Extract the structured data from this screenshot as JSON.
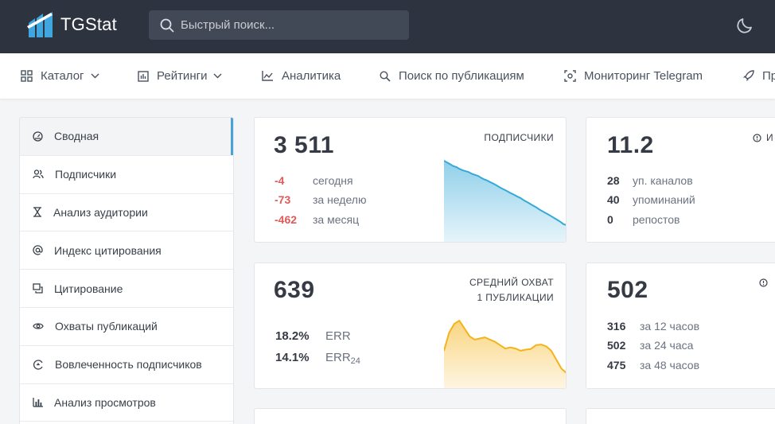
{
  "header": {
    "logo_text": "TGStat",
    "search_placeholder": "Быстрый поиск..."
  },
  "nav": {
    "items": [
      {
        "label": "Каталог",
        "icon": "grid-icon",
        "dropdown": true
      },
      {
        "label": "Рейтинги",
        "icon": "chart-box-icon",
        "dropdown": true
      },
      {
        "label": "Аналитика",
        "icon": "line-chart-icon",
        "dropdown": false
      },
      {
        "label": "Поиск по публикациям",
        "icon": "search-icon",
        "dropdown": false
      },
      {
        "label": "Мониторинг Telegram",
        "icon": "monitor-icon",
        "dropdown": false
      },
      {
        "label": "Пр",
        "icon": "rocket-icon",
        "dropdown": false
      }
    ]
  },
  "sidebar": {
    "items": [
      {
        "label": "Сводная",
        "icon": "dashboard-icon"
      },
      {
        "label": "Подписчики",
        "icon": "users-icon"
      },
      {
        "label": "Анализ аудитории",
        "icon": "hourglass-icon"
      },
      {
        "label": "Индекс цитирования",
        "icon": "at-icon"
      },
      {
        "label": "Цитирование",
        "icon": "quote-icon"
      },
      {
        "label": "Охваты публикаций",
        "icon": "eye-icon"
      },
      {
        "label": "Вовлеченность подписчиков",
        "icon": "engagement-icon"
      },
      {
        "label": "Анализ просмотров",
        "icon": "bar-chart-icon"
      }
    ]
  },
  "cards": {
    "subscribers": {
      "value": "3 511",
      "title": "подписчики",
      "rows": [
        {
          "value": "-4",
          "label": "сегодня"
        },
        {
          "value": "-73",
          "label": "за неделю"
        },
        {
          "value": "-462",
          "label": "за месяц"
        }
      ],
      "color": "#35a9d8"
    },
    "citation": {
      "value": "11.2",
      "title_partial": "И",
      "rows": [
        {
          "value": "28",
          "label": "уп. каналов"
        },
        {
          "value": "40",
          "label": "упоминаний"
        },
        {
          "value": "0",
          "label": "репостов"
        }
      ]
    },
    "reach": {
      "value": "639",
      "title_line1": "средний охват",
      "title_line2": "1 публикации",
      "rows": [
        {
          "value": "18.2%",
          "label": "ERR",
          "sub": ""
        },
        {
          "value": "14.1%",
          "label": "ERR",
          "sub": "24"
        }
      ],
      "color": "#f5b31b"
    },
    "views": {
      "value": "502",
      "rows": [
        {
          "value": "316",
          "label": "за 12 часов"
        },
        {
          "value": "502",
          "label": "за 24 часа"
        },
        {
          "value": "475",
          "label": "за 48 часов"
        }
      ]
    }
  },
  "chart_data": [
    {
      "type": "area",
      "name": "subscribers-trend",
      "values": [
        3973,
        3960,
        3948,
        3935,
        3928,
        3915,
        3905,
        3898,
        3892,
        3880,
        3872,
        3865,
        3852,
        3840,
        3832,
        3820,
        3810,
        3798,
        3785,
        3773,
        3762,
        3750,
        3738,
        3728,
        3715,
        3705,
        3690,
        3678,
        3665,
        3652,
        3640,
        3625,
        3612,
        3600,
        3588,
        3575,
        3562,
        3548,
        3535,
        3518,
        3511
      ],
      "color": "#35a9d8"
    },
    {
      "type": "area",
      "name": "reach-trend",
      "values": [
        640,
        720,
        760,
        775,
        740,
        705,
        690,
        695,
        700,
        690,
        680,
        665,
        650,
        655,
        650,
        640,
        645,
        648,
        665,
        668,
        660,
        640,
        600,
        560,
        540
      ],
      "color": "#f5b31b"
    }
  ]
}
